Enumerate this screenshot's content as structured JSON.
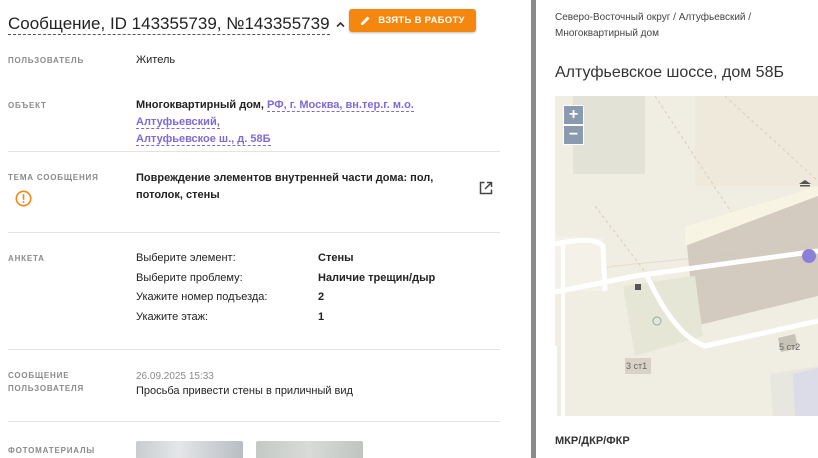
{
  "header": {
    "title": "Сообщение, ID 143355739, №143355739",
    "take_button": "ВЗЯТЬ В РАБОТУ"
  },
  "fields": {
    "user": {
      "label": "ПОЛЬЗОВАТЕЛЬ",
      "value": "Житель"
    },
    "object": {
      "label": "ОБЪЕКТ",
      "type": "Многоквартирный дом,",
      "link_line1": "РФ, г. Москва, вн.тер.г. м.о. Алтуфьевский,",
      "link_line2": "Алтуфьевское ш., д. 58Б"
    },
    "topic": {
      "label": "ТЕМА СООБЩЕНИЯ",
      "line1": "Повреждение элементов внутренней части дома: пол,",
      "line2": "потолок, стены"
    },
    "anketa": {
      "label": "АНКЕТА",
      "rows": [
        {
          "q": "Выберите элемент:",
          "a": "Стены"
        },
        {
          "q": "Выберите проблему:",
          "a": "Наличие трещин/дыр"
        },
        {
          "q": "Укажите номер подъезда:",
          "a": "2"
        },
        {
          "q": "Укажите этаж:",
          "a": "1"
        }
      ]
    },
    "message": {
      "label_line1": "СООБЩЕНИЕ",
      "label_line2": "ПОЛЬЗОВАТЕЛЯ",
      "datetime": "26.09.2025 15:33",
      "text": "Просьба привести стены в приличный вид"
    },
    "photos": {
      "label": "ФОТОМАТЕРИАЛЫ"
    }
  },
  "right": {
    "breadcrumb_line1": "Северо-Восточный округ / Алтуфьевский /",
    "breadcrumb_line2": "Многоквартирный дом",
    "address": "Алтуфьевское шоссе, дом 58Б",
    "map": {
      "zoom_in": "+",
      "zoom_out": "−",
      "label_1": "3 ст1",
      "label_2": "5 ст2",
      "marker_color": "#8c7fd8"
    },
    "section": "МКР/ДКР/ФКР"
  },
  "colors": {
    "accent_orange": "#f5870f",
    "link_purple": "#7e6ad6",
    "warning_orange": "#f5870f"
  }
}
